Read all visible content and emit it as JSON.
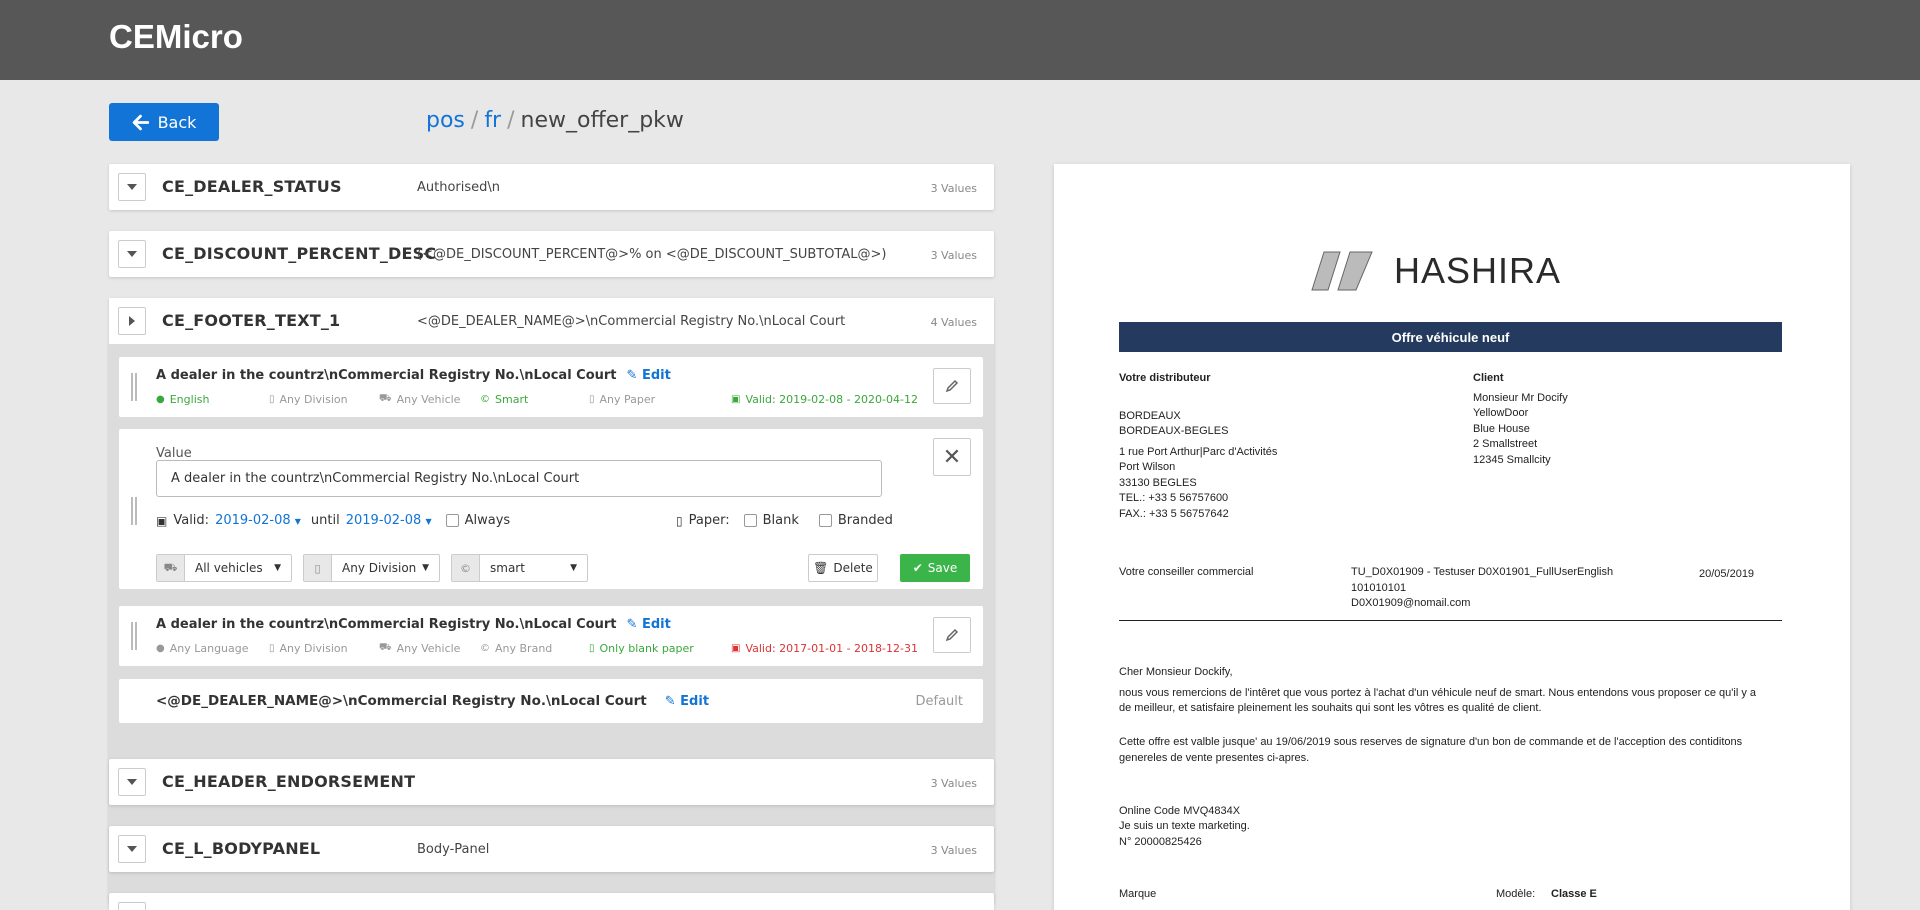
{
  "app": {
    "title": "CEMicro"
  },
  "back_button": {
    "label": "Back"
  },
  "breadcrumb": {
    "parts": [
      "pos",
      "fr"
    ],
    "current": "new_offer_pkw",
    "separator": "/"
  },
  "keys": [
    {
      "name": "CE_DEALER_STATUS",
      "value": "Authorised\\n",
      "count": "3 Values"
    },
    {
      "name": "CE_DISCOUNT_PERCENT_DESC",
      "value": "(<@DE_DISCOUNT_PERCENT@>% on <@DE_DISCOUNT_SUBTOTAL@>)",
      "count": "3 Values"
    },
    {
      "name": "CE_FOOTER_TEXT_1",
      "value": "<@DE_DEALER_NAME@>\\nCommercial Registry No.\\nLocal Court",
      "count": "4 Values"
    },
    {
      "name": "CE_HEADER_ENDORSEMENT",
      "value": "",
      "count": "3 Values"
    },
    {
      "name": "CE_L_BODYPANEL",
      "value": "Body-Panel",
      "count": "3 Values"
    }
  ],
  "values": {
    "card1": {
      "title": "A dealer in the countrz\\nCommercial Registry No.\\nLocal Court",
      "edit": "Edit",
      "meta": [
        "English",
        "Any Division",
        "Any Vehicle",
        "Smart",
        "Any Paper",
        "Valid: 2019-02-08 - 2020-04-12"
      ]
    },
    "editor": {
      "value_label": "Value",
      "value": "A dealer in the countrz\\nCommercial Registry No.\\nLocal Court",
      "valid_label": "Valid:",
      "valid_from": "2019-02-08",
      "until_label": "until",
      "valid_until": "2019-02-08",
      "always_label": "Always",
      "paper_label": "Paper:",
      "blank_label": "Blank",
      "branded_label": "Branded",
      "vehicle_select": "All vehicles",
      "division_select": "Any Division",
      "brand_select": "smart",
      "delete_label": "Delete",
      "save_label": "Save"
    },
    "card2": {
      "title": "A dealer in the countrz\\nCommercial Registry No.\\nLocal Court",
      "edit": "Edit",
      "meta": [
        "Any Language",
        "Any Division",
        "Any Vehicle",
        "Any Brand",
        "Only blank paper",
        "Valid: 2017-01-01 - 2018-12-31"
      ]
    },
    "default_card": {
      "title": "<@DE_DEALER_NAME@>\\nCommercial Registry No.\\nLocal Court",
      "edit": "Edit",
      "default_label": "Default"
    }
  },
  "preview": {
    "brand": "HASHIRA",
    "title": "Offre véhicule neuf",
    "dealer_heading": "Votre distributeur",
    "dealer_lines": [
      "BORDEAUX",
      "BORDEAUX-BEGLES"
    ],
    "dealer_address": [
      "1 rue Port Arthur|Parc d'Activités",
      "Port Wilson",
      "33130 BEGLES",
      "TEL.: +33 5 56757600",
      "FAX.: +33 5 56757642"
    ],
    "client_heading": "Client",
    "client_lines": [
      "Monsieur Mr Docify",
      "YellowDoor",
      "Blue House",
      "2 Smallstreet",
      "12345 Smallcity"
    ],
    "advisor_label": "Votre conseiller commercial",
    "advisor_lines": [
      "TU_D0X01909 - Testuser D0X01901_FullUserEnglish",
      "101010101",
      "D0X01909@nomail.com"
    ],
    "date": "20/05/2019",
    "greeting": "Cher Monsieur Dockify,",
    "para1": [
      "nous vous remercions de l'intêret que vous portez à l'achat d'un véhicule neuf de smart. Nous entendons vous proposer ce qu'il y a",
      "de meilleur, et satisfaire pleinement les souhaits qui sont les vôtres es qualité de client."
    ],
    "para2": [
      "Cette offre est valble jusque' au 19/06/2019 sous reserves de signature d'un bon de commande et de l'acception des contiditons",
      "genereles de vente presentes ci-apres."
    ],
    "online_lines": [
      "Online Code MVQ4834X",
      "Je suis un texte marketing.",
      "N° 20000825426"
    ],
    "marque_label": "Marque",
    "modele_label": "Modèle:",
    "modele_value": "Classe E"
  },
  "colors": {
    "accent": "#1274d6",
    "topbar": "#575757",
    "save": "#3bb54a",
    "doc_title": "#243a5e"
  }
}
